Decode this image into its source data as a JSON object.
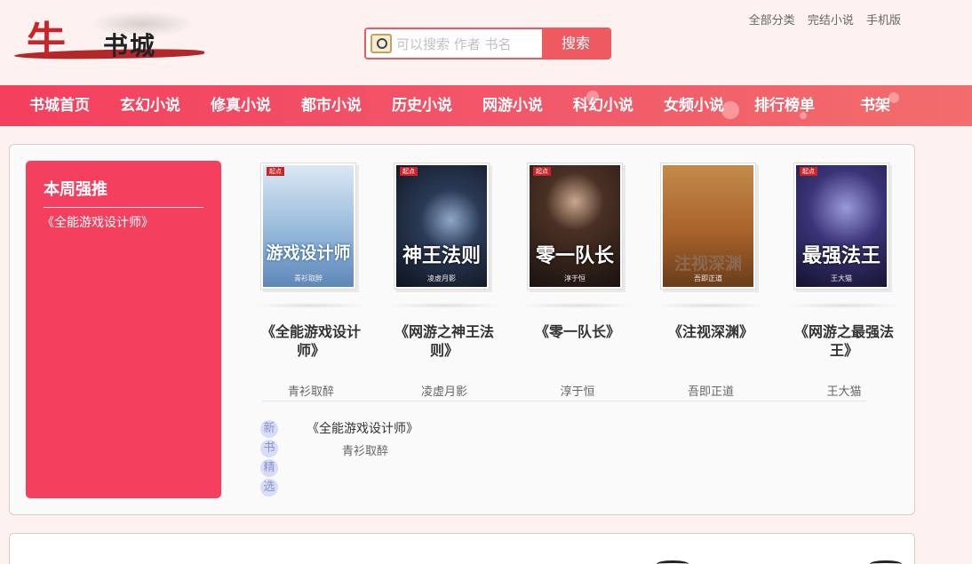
{
  "header": {
    "logo_big": "牛",
    "logo_small": "书城",
    "search_placeholder": "可以搜索 作者 书名",
    "search_button": "搜索",
    "links": [
      "全部分类",
      "完结小说",
      "手机版"
    ]
  },
  "nav": {
    "items": [
      "书城首页",
      "玄幻小说",
      "修真小说",
      "都市小说",
      "历史小说",
      "网游小说",
      "科幻小说",
      "女频小说",
      "排行榜单",
      "书架"
    ]
  },
  "weekly": {
    "title": "本周强推",
    "items": [
      "《全能游戏设计师》"
    ]
  },
  "books": [
    {
      "title_line1": "《全能游戏设计",
      "title_line2": "师》",
      "author": "青衫取醉",
      "cover_text": "游戏设计师",
      "cover_author": "青衫取醉",
      "color": "#8fb4d8"
    },
    {
      "title_line1": "《网游之神王法",
      "title_line2": "则》",
      "author": "凌虚月影",
      "cover_text": "神王法则",
      "cover_author": "凌虚月影",
      "color": "#1a2436"
    },
    {
      "title_line1": "《零一队长》",
      "title_line2": "",
      "author": "淳于恒",
      "cover_text": "零一队长",
      "cover_author": "淳于恒",
      "color": "#3a2a22"
    },
    {
      "title_line1": "《注视深渊》",
      "title_line2": "",
      "author": "吾即正道",
      "cover_text": "注视深渊",
      "cover_author": "吾即正道",
      "color": "#b5702e"
    },
    {
      "title_line1": "《网游之最强法",
      "title_line2": "王》",
      "author": "王大猫",
      "cover_text": "最强法王",
      "cover_author": "王大猫",
      "color": "#2d2860"
    }
  ],
  "newpicks": {
    "label": [
      "新",
      "书",
      "精",
      "选"
    ],
    "title": "《全能游戏设计师》",
    "author": "青衫取醉"
  },
  "colors": {
    "accent": "#f43f5e",
    "search_border": "#ee5a5f"
  }
}
